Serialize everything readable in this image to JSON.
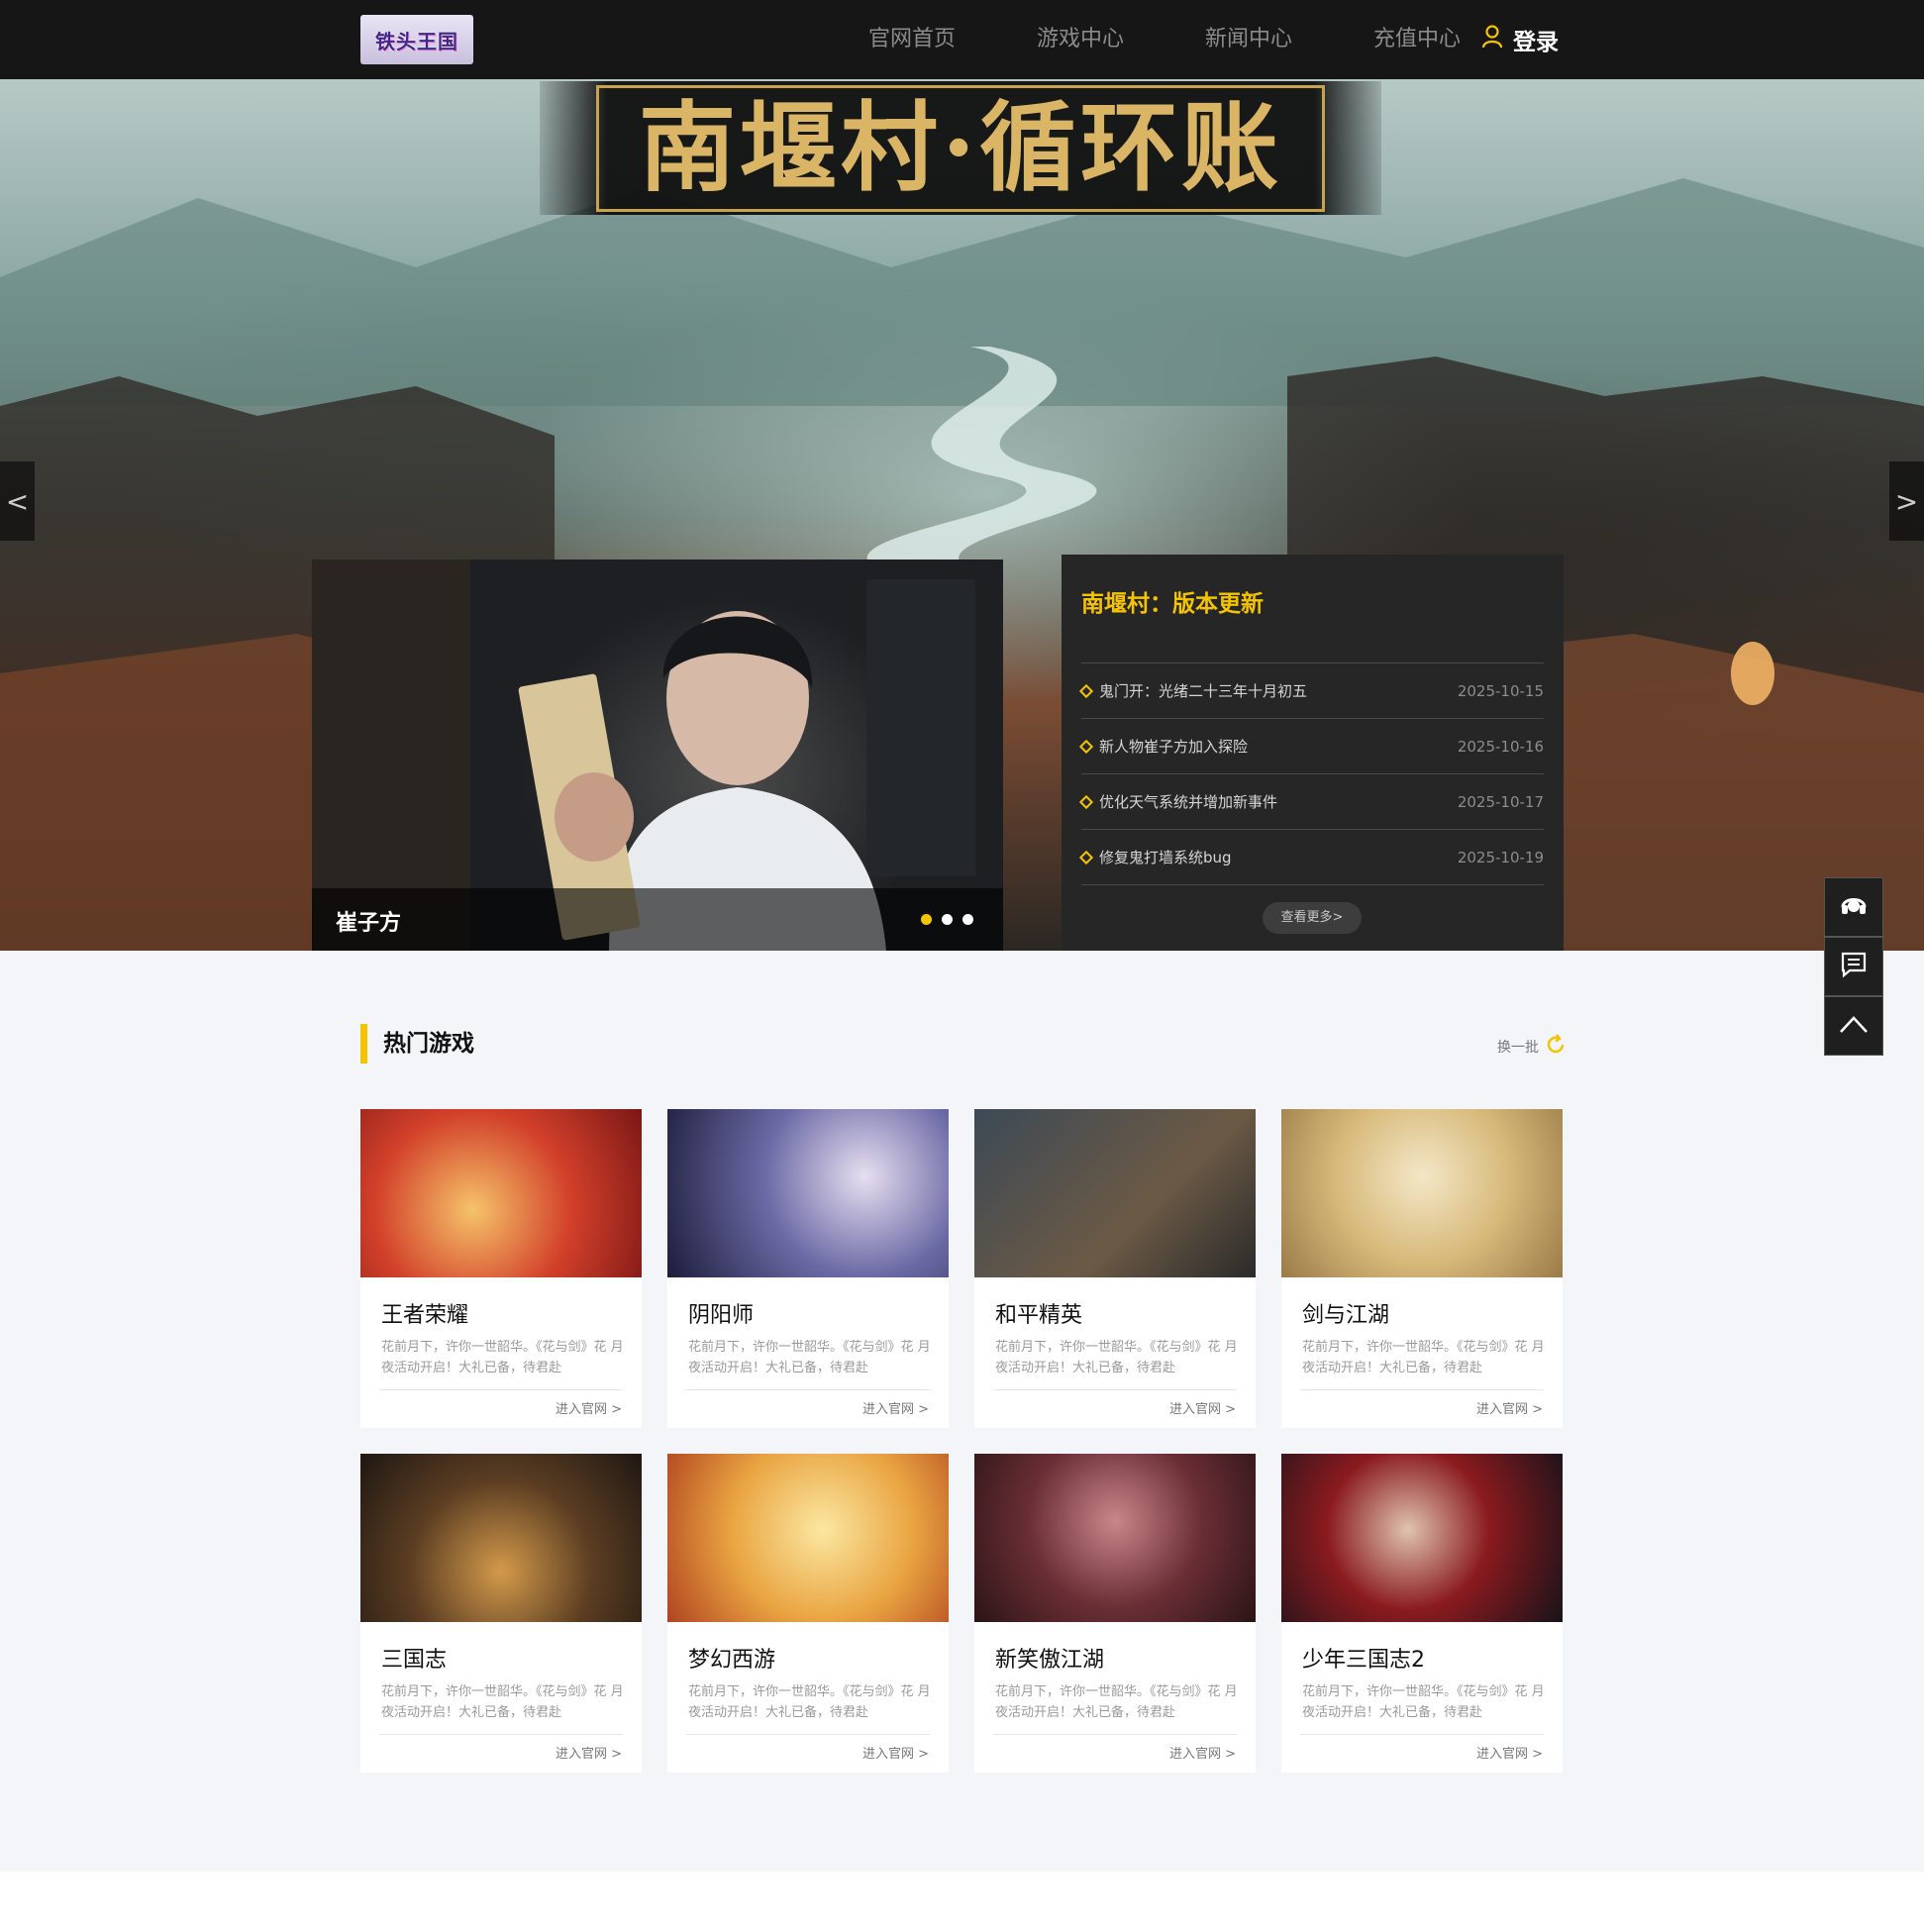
{
  "header": {
    "logo_text": "铁头王国",
    "nav": [
      "官网首页",
      "游戏中心",
      "新闻中心",
      "充值中心"
    ],
    "login_label": "登录"
  },
  "hero": {
    "title": "南堰村·循环账",
    "prev_label": "<",
    "next_label": ">",
    "slide_count": 3,
    "active_slide": 3
  },
  "feature": {
    "name": "崔子方",
    "slide_count": 3,
    "active_slide": 1
  },
  "news": {
    "title": "南堰村：版本更新",
    "items": [
      {
        "title": "鬼门开：光绪二十三年十月初五",
        "date": "2025-10-15"
      },
      {
        "title": "新人物崔子方加入探险",
        "date": "2025-10-16"
      },
      {
        "title": "优化天气系统并增加新事件",
        "date": "2025-10-17"
      },
      {
        "title": "修复鬼打墙系统bug",
        "date": "2025-10-19"
      }
    ],
    "more_label": "查看更多>"
  },
  "side_tools": [
    "headset-icon",
    "message-icon",
    "arrow-up-icon"
  ],
  "games_section": {
    "title": "热门游戏",
    "refresh_label": "换一批",
    "games": [
      {
        "name": "王者荣耀",
        "desc": "花前月下，许你一世韶华。《花与剑》花 月夜活动开启！大礼已备，待君赴",
        "link": "进入官网 >"
      },
      {
        "name": "阴阳师",
        "desc": "花前月下，许你一世韶华。《花与剑》花 月夜活动开启！大礼已备，待君赴",
        "link": "进入官网 >"
      },
      {
        "name": "和平精英",
        "desc": "花前月下，许你一世韶华。《花与剑》花 月夜活动开启！大礼已备，待君赴",
        "link": "进入官网 >"
      },
      {
        "name": "剑与江湖",
        "desc": "花前月下，许你一世韶华。《花与剑》花 月夜活动开启！大礼已备，待君赴",
        "link": "进入官网 >"
      },
      {
        "name": "三国志",
        "desc": "花前月下，许你一世韶华。《花与剑》花 月夜活动开启！大礼已备，待君赴",
        "link": "进入官网 >"
      },
      {
        "name": "梦幻西游",
        "desc": "花前月下，许你一世韶华。《花与剑》花 月夜活动开启！大礼已备，待君赴",
        "link": "进入官网 >"
      },
      {
        "name": "新笑傲江湖",
        "desc": "花前月下，许你一世韶华。《花与剑》花 月夜活动开启！大礼已备，待君赴",
        "link": "进入官网 >"
      },
      {
        "name": "少年三国志2",
        "desc": "花前月下，许你一世韶华。《花与剑》花 月夜活动开启！大礼已备，待君赴",
        "link": "进入官网 >"
      }
    ]
  },
  "colors": {
    "accent": "#f5c400",
    "header_bg": "#161616",
    "panel_bg": "#262626",
    "section_bg": "#f4f5f8"
  }
}
